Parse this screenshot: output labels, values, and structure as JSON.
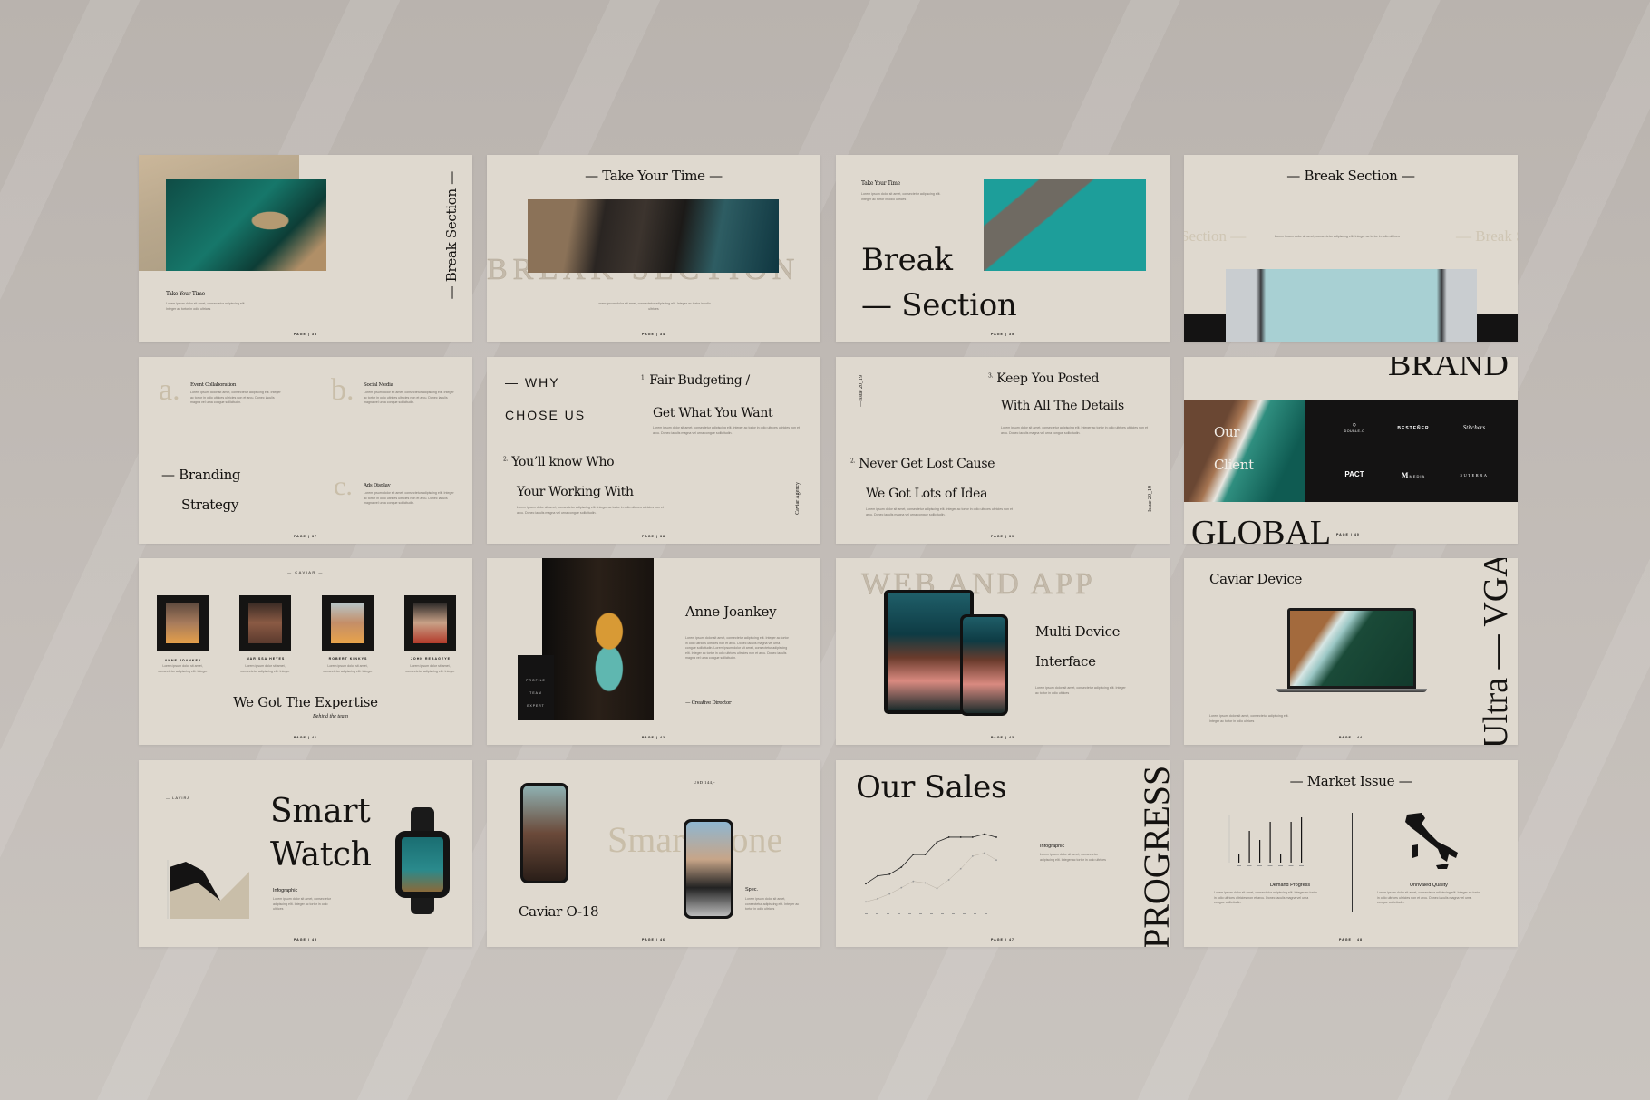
{
  "lorem_short": "Lorem ipsum dolor sit amet, consectetur adipiscing elit. Integer ac tortor in odio ultrices",
  "lorem_long": "Lorem ipsum dolor sit amet, consectetur adipiscing elit. Integer ac tortor in odio ultrices ultricies non et arcu. Donec iaculis magna vel urna congue sollicitudin.",
  "colors": {
    "background": "#bcb6b1",
    "slide": "#dfd9cf",
    "ink": "#141210",
    "tan": "#c9bea9",
    "dark_band": "#141313"
  },
  "slides": [
    {
      "title": "Break Section",
      "subtitle": "Take Your Time",
      "page": "PAGE | 33"
    },
    {
      "title": "Take Your Time",
      "ghost": "BREAK SECTION",
      "page": "PAGE | 34"
    },
    {
      "kicker": "Take Your Time",
      "line1": "Break",
      "line2": "Section",
      "page": "PAGE | 35"
    },
    {
      "title": "Break Section",
      "ghost_left": "Section —",
      "ghost_right": "— Break S"
    },
    {
      "items": [
        {
          "letter": "a.",
          "title": "Event Collaboration"
        },
        {
          "letter": "b.",
          "title": "Social Media"
        },
        {
          "letter": "c.",
          "title": "Ads Display"
        }
      ],
      "line1": "Branding",
      "line2": "Strategy",
      "page": "PAGE | 37"
    },
    {
      "why1": "WHY",
      "why2": "CHOSE US",
      "p1_num": "1.",
      "p1a": "Fair Budgeting /",
      "p1b": "Get What You Want",
      "p2_num": "2.",
      "p2a": "You’ll know Who",
      "p2b": "Your Working With",
      "side": "Caviar Agency",
      "page": "PAGE | 38"
    },
    {
      "issue": "—Issue 20_19",
      "p3_num": "3.",
      "p3a": "Keep You Posted",
      "p3b": "With All The Details",
      "p2_num": "2.",
      "p2a": "Never Get Lost Cause",
      "p2b": "We Got Lots of Idea",
      "page": "PAGE | 39"
    },
    {
      "top": "BRAND",
      "bottom": "GLOBAL",
      "our": "Our",
      "client": "Client",
      "logos": [
        "DOUBLE-O",
        "BESTEÑER",
        "Stitchers",
        "PACT",
        "MEDIA",
        "SUTERRA"
      ],
      "page": "PAGE | 40"
    },
    {
      "kicker": "— CAVIAR —",
      "team": [
        {
          "name": "ANNE JOANKEY"
        },
        {
          "name": "MARISSA HEYES"
        },
        {
          "name": "ROBERT KINKYS"
        },
        {
          "name": "JOHN REBAGEYE"
        }
      ],
      "title": "We Got The Expertise",
      "subtitle": "Behind the team",
      "page": "PAGE | 41"
    },
    {
      "name": "Anne Joankey",
      "role": "— Creative Director",
      "box": [
        "PROFILE",
        "TEAM",
        "EXPERT"
      ],
      "page": "PAGE | 42"
    },
    {
      "ghost": "WEB AND APP",
      "line1": "Multi Device",
      "line2": "Interface",
      "page": "PAGE | 43"
    },
    {
      "title": "Caviar Device",
      "side": "Ultra — VGA",
      "page": "PAGE | 44"
    },
    {
      "kicker": "— LAVIRA",
      "line1": "Smart",
      "line2": "Watch",
      "label": "Infographic",
      "page": "PAGE | 45"
    },
    {
      "price": "USD 144,-",
      "ghost": "Smartphone",
      "spec": "Spec.",
      "title": "Caviar O-18",
      "page": "PAGE | 46"
    },
    {
      "title": "Our Sales",
      "label": "Infographic",
      "side": "PROGRESS",
      "page": "PAGE | 47",
      "line_series": [
        [
          33,
          43,
          45,
          54,
          70,
          70,
          86,
          92,
          92,
          92,
          96,
          92
        ],
        [
          10,
          14,
          20,
          28,
          36,
          34,
          27,
          38,
          52,
          68,
          72,
          63
        ]
      ]
    },
    {
      "title": "Market Issue",
      "left_label": "Demand Progress",
      "right_label": "Unrivaled Quality",
      "page": "PAGE | 48",
      "bars": [
        2,
        7,
        5,
        9,
        2,
        9,
        10
      ]
    }
  ]
}
